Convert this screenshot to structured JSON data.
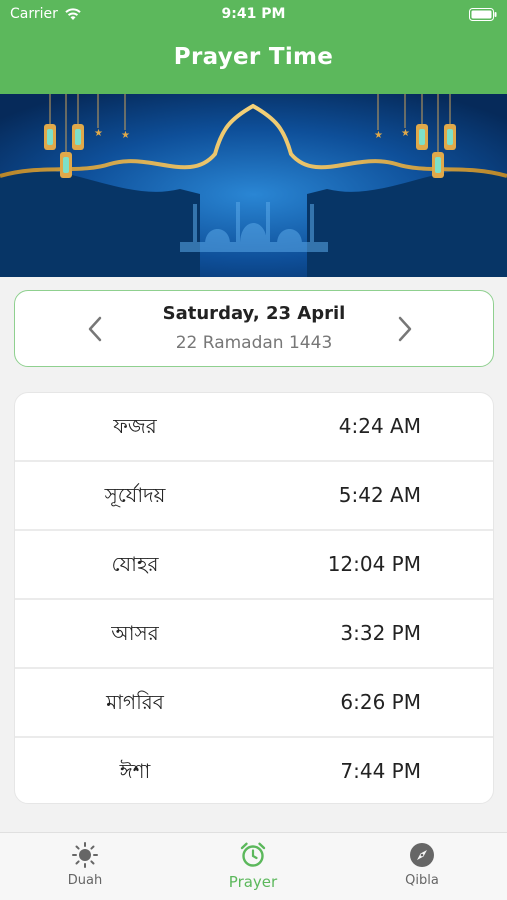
{
  "status_bar": {
    "carrier": "Carrier",
    "time": "9:41 PM"
  },
  "header": {
    "title": "Prayer Time",
    "color": "#5cb85c"
  },
  "date": {
    "gregorian": "Saturday, 23 April",
    "hijri": "22 Ramadan 1443"
  },
  "prayers": [
    {
      "name": "ফজর",
      "time": "4:24 AM"
    },
    {
      "name": "সূর্যোদয়",
      "time": "5:42 AM"
    },
    {
      "name": "যোহর",
      "time": "12:04 PM"
    },
    {
      "name": "আসর",
      "time": "3:32 PM"
    },
    {
      "name": "মাগরিব",
      "time": "6:26 PM"
    },
    {
      "name": "ঈশা",
      "time": "7:44 PM"
    }
  ],
  "tabs": [
    {
      "label": "Duah",
      "icon": "sun-icon"
    },
    {
      "label": "Prayer",
      "icon": "alarm-clock-icon",
      "active": true
    },
    {
      "label": "Qibla",
      "icon": "compass-icon"
    }
  ]
}
